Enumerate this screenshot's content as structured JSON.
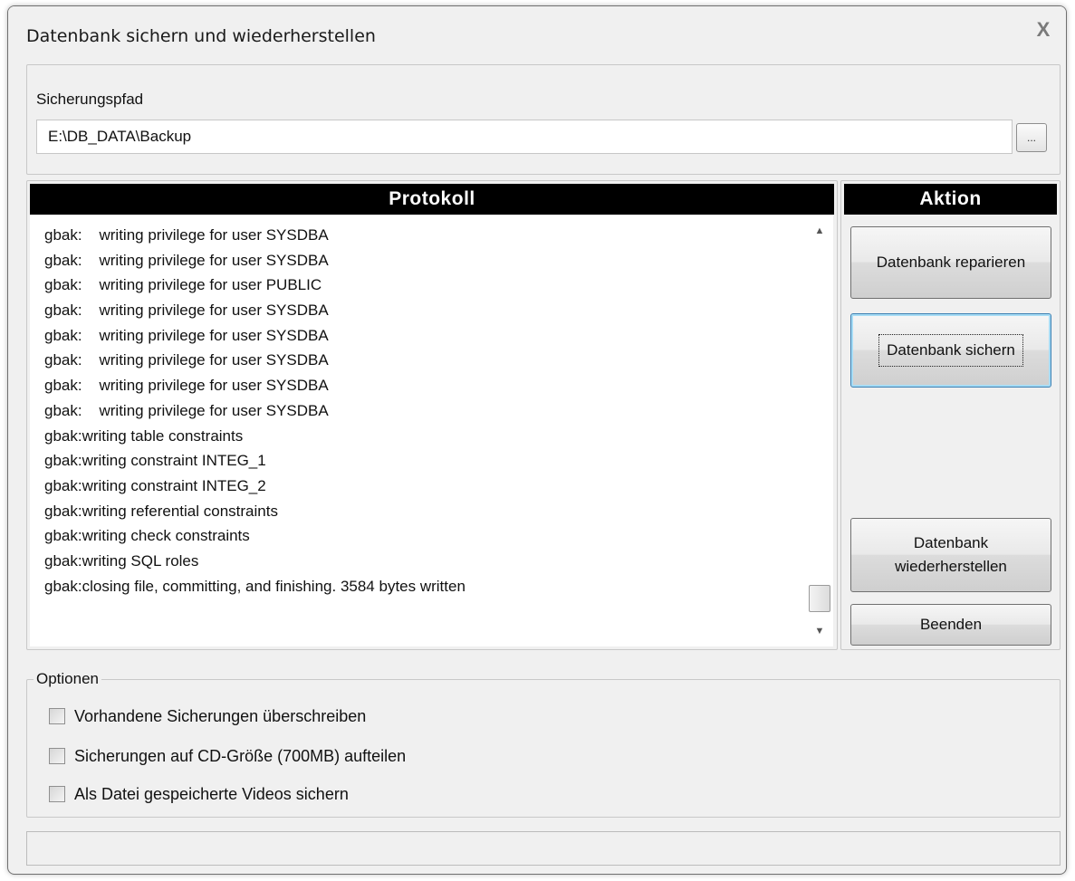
{
  "window": {
    "title": "Datenbank sichern und wiederherstellen",
    "close_label": "X"
  },
  "backup_path": {
    "label": "Sicherungspfad",
    "value": "E:\\DB_DATA\\Backup",
    "browse_label": "..."
  },
  "log": {
    "header": "Protokoll",
    "lines": [
      "gbak:    writing privilege for user SYSDBA",
      "gbak:    writing privilege for user SYSDBA",
      "gbak:    writing privilege for user PUBLIC",
      "gbak:    writing privilege for user SYSDBA",
      "gbak:    writing privilege for user SYSDBA",
      "gbak:    writing privilege for user SYSDBA",
      "gbak:    writing privilege for user SYSDBA",
      "gbak:    writing privilege for user SYSDBA",
      "gbak:writing table constraints",
      "gbak:writing constraint INTEG_1",
      "gbak:writing constraint INTEG_2",
      "gbak:writing referential constraints",
      "gbak:writing check constraints",
      "gbak:writing SQL roles",
      "gbak:closing file, committing, and finishing. 3584 bytes written"
    ],
    "scroll_up": "▲",
    "scroll_down": "▼"
  },
  "actions": {
    "header": "Aktion",
    "repair": "Datenbank reparieren",
    "backup": "Datenbank sichern",
    "restore_line1": "Datenbank",
    "restore_line2": "wiederherstellen",
    "exit": "Beenden"
  },
  "options": {
    "legend": "Optionen",
    "overwrite": "Vorhandene Sicherungen überschreiben",
    "split_cd": "Sicherungen auf CD-Größe (700MB) aufteilen",
    "backup_videos": "Als Datei gespeicherte Videos sichern"
  },
  "status": {
    "text": ""
  }
}
